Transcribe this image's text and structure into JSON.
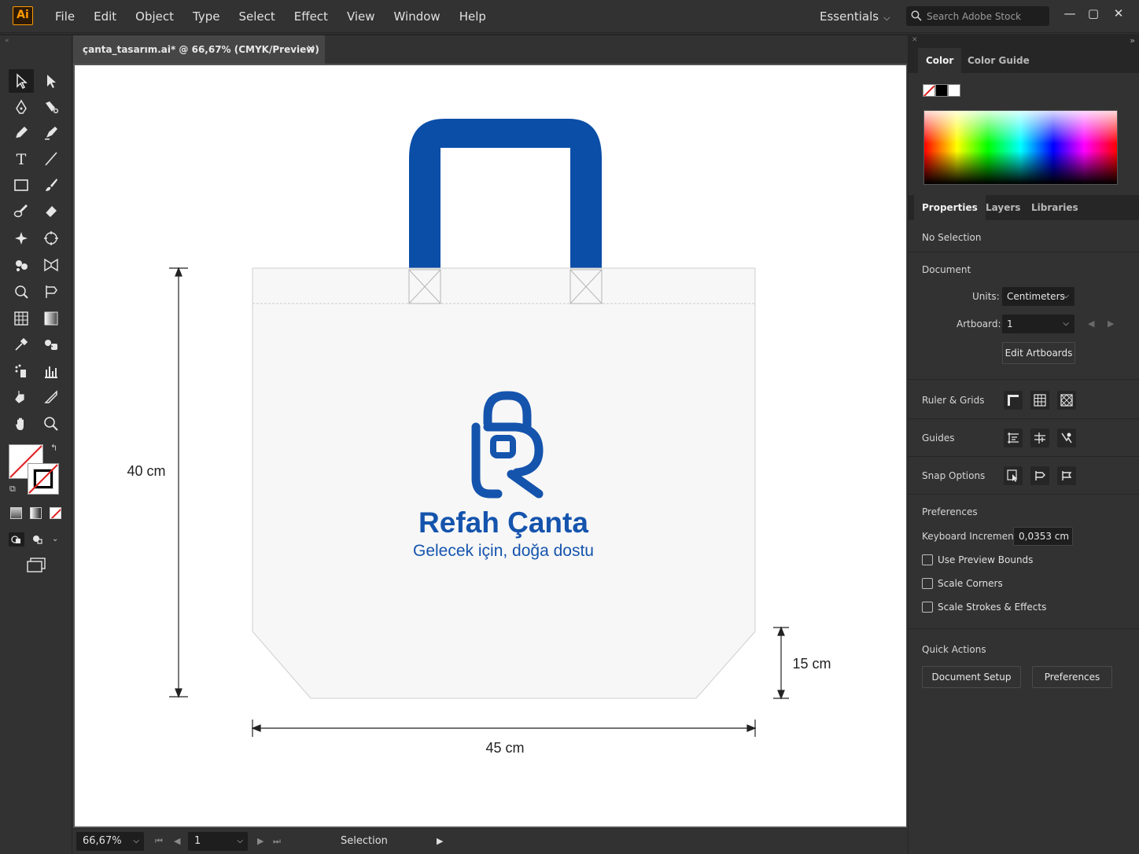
{
  "app": {
    "logo_text": "Ai",
    "menu": [
      "File",
      "Edit",
      "Object",
      "Type",
      "Select",
      "Effect",
      "View",
      "Window",
      "Help"
    ],
    "workspace": "Essentials",
    "stock_search_placeholder": "Search Adobe Stock"
  },
  "document_tab": {
    "title": "çanta_tasarım.ai* @ 66,67% (CMYK/Preview)",
    "close_glyph": "✕"
  },
  "artwork": {
    "brand_name": "Refah Çanta",
    "tagline": "Gelecek için, doğa dostu",
    "dim_height": "40 cm",
    "dim_width": "45 cm",
    "dim_gusset": "15 cm",
    "handle_color": "#0b4ea8",
    "logo_color": "#1554ad"
  },
  "status_bar": {
    "zoom": "66,67%",
    "artboard_number": "1",
    "current_tool": "Selection"
  },
  "panel": {
    "color_tabs": [
      "Color",
      "Color Guide"
    ],
    "property_tabs": [
      "Properties",
      "Layers",
      "Libraries"
    ],
    "selection_state": "No Selection",
    "document_heading": "Document",
    "units_label": "Units:",
    "units_value": "Centimeters",
    "artboard_label": "Artboard:",
    "artboard_value": "1",
    "edit_artboards": "Edit Artboards",
    "ruler_grids": "Ruler & Grids",
    "guides": "Guides",
    "snap_options": "Snap Options",
    "preferences_heading": "Preferences",
    "keyboard_increment_label": "Keyboard Increment:",
    "keyboard_increment_value": "0,0353 cm",
    "checkboxes": [
      "Use Preview Bounds",
      "Scale Corners",
      "Scale Strokes & Effects"
    ],
    "quick_actions_heading": "Quick Actions",
    "document_setup_button": "Document Setup",
    "preferences_button": "Preferences"
  },
  "colors": {
    "ui_background": "#323232",
    "ui_dark": "#262626",
    "accent_orange": "#ff9a00"
  }
}
